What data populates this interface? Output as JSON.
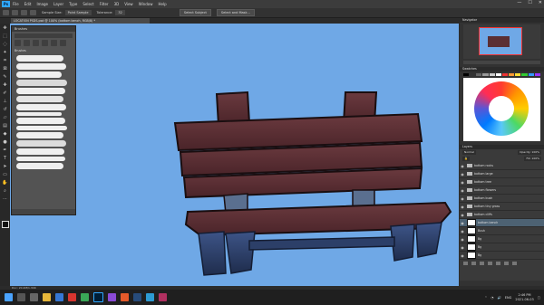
{
  "app": {
    "logo": "Ps"
  },
  "menu": [
    "File",
    "Edit",
    "Image",
    "Layer",
    "Type",
    "Select",
    "Filter",
    "3D",
    "View",
    "Window",
    "Help"
  ],
  "window_controls": [
    "—",
    "☐",
    "✕"
  ],
  "options_bar": {
    "sample_label": "Sample Size:",
    "sample_value": "Point Sample",
    "tolerance_label": "Tolerance:",
    "tolerance_value": "32",
    "select_subject": "Select Subject",
    "select_and_mask": "Select and Mask..."
  },
  "document_tab": "LOCATION PSDS.psd @ 100% (bottom bench, RGB/8) *",
  "brushes_panel": {
    "title": "Brushes",
    "folder": "Brushes"
  },
  "status_text": "Doc: 20.4M/1.34K",
  "right_panels": {
    "navigator_title": "Navigator",
    "swatches_title": "Swatches",
    "layers_title": "Layers",
    "blend_mode": "Normal",
    "opacity": "Opacity: 100%",
    "fill": "Fill: 100%"
  },
  "layers": [
    {
      "name": "bottom rocks",
      "type": "folder",
      "active": false
    },
    {
      "name": "bottom large",
      "type": "folder",
      "active": false
    },
    {
      "name": "bottom tree",
      "type": "folder",
      "active": false
    },
    {
      "name": "bottom flowers",
      "type": "folder",
      "active": false
    },
    {
      "name": "bottom bush",
      "type": "folder",
      "active": false
    },
    {
      "name": "bottom tiny grass",
      "type": "folder",
      "active": false
    },
    {
      "name": "bottom cliffs",
      "type": "folder",
      "active": false
    },
    {
      "name": "bottom bench",
      "type": "layer",
      "active": true
    },
    {
      "name": "Bush",
      "type": "layer",
      "active": false
    },
    {
      "name": "Bg",
      "type": "layer",
      "active": false
    },
    {
      "name": "Bg",
      "type": "layer",
      "active": false
    },
    {
      "name": "Bg",
      "type": "layer",
      "active": false
    }
  ],
  "taskbar": {
    "time": "2:46 PM",
    "date": "2021-06-03",
    "lang": "ENG"
  },
  "colors": {
    "canvas_bg": "#6fa8e6",
    "bench_wood": "#5b2f33",
    "bench_leg": "#2c3f68",
    "ps_accent": "#31a8ff"
  }
}
